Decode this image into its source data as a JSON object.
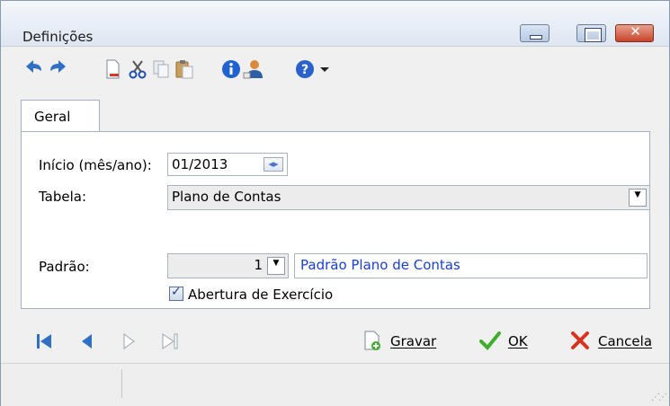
{
  "window": {
    "title": "Definições",
    "controls": {
      "minimize": "minimize",
      "maximize": "maximize",
      "close": "x"
    }
  },
  "toolbar": {
    "items": [
      {
        "icon": "undo-icon"
      },
      {
        "icon": "redo-icon"
      },
      {
        "icon": "new-document-icon"
      },
      {
        "icon": "cut-icon"
      },
      {
        "icon": "copy-icon"
      },
      {
        "icon": "paste-icon"
      },
      {
        "icon": "info-icon"
      },
      {
        "icon": "user-icon"
      },
      {
        "icon": "help-icon"
      },
      {
        "icon": "chevron-down-icon"
      }
    ]
  },
  "tabs": [
    {
      "label": "Geral",
      "active": true
    }
  ],
  "form": {
    "inicio": {
      "label": "Início (mês/ano):",
      "value": "01/2013"
    },
    "tabela": {
      "label": "Tabela:",
      "value": "Plano de Contas"
    },
    "padrao": {
      "label": "Padrão:",
      "number": "1",
      "name": "Padrão Plano de Contas"
    },
    "abertura": {
      "label": "Abertura de Exercício",
      "checked": true
    }
  },
  "navigation": [
    "first-record-icon",
    "previous-record-icon",
    "next-record-icon",
    "last-record-icon"
  ],
  "actions": {
    "gravar": "Gravar",
    "ok": "OK",
    "cancela": "Cancela"
  },
  "colors": {
    "accent_blue": "#1a3fd6",
    "close_red": "#c7442a",
    "ok_green": "#3dae2b"
  }
}
